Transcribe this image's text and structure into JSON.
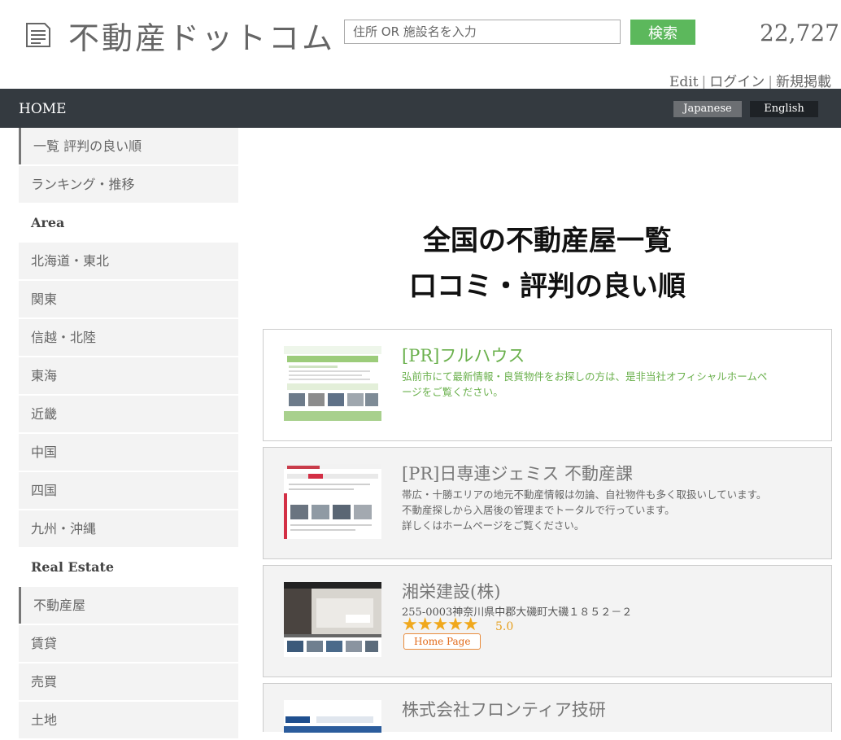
{
  "header": {
    "site_title": "不動産ドットコム",
    "search_placeholder": "住所 OR 施設名を入力",
    "search_button": "検索",
    "visitor_count": "22,727",
    "links": [
      "Edit",
      "ログイン",
      "新規掲載"
    ]
  },
  "nav": {
    "home": "HOME",
    "languages": [
      "Japanese",
      "English"
    ]
  },
  "sidebar": {
    "sort_items": [
      "一覧 評判の良い順",
      "ランキング・推移"
    ],
    "area_heading": "Area",
    "areas": [
      "北海道・東北",
      "関東",
      "信越・北陸",
      "東海",
      "近畿",
      "中国",
      "四国",
      "九州・沖縄"
    ],
    "realestate_heading": "Real Estate",
    "categories": [
      "不動産屋",
      "賃貸",
      "売買",
      "土地"
    ]
  },
  "main": {
    "title_line1": "全国の不動産屋一覧",
    "title_line2": "口コミ・評判の良い順",
    "listings": [
      {
        "name": "[PR]フルハウス",
        "desc": "弘前市にて最新情報・良質物件をお探しの方は、是非当社オフィシャルホームページをご覧ください。",
        "name_color": "#6ab04c"
      },
      {
        "name": "[PR]日専連ジェミス 不動産課",
        "desc_lines": [
          "帯広・十勝エリアの地元不動産情報は勿論、自社物件も多く取扱いしています。",
          "不動産探しから入居後の管理までトータルで行っています。",
          "詳しくはホームページをご覧ください。"
        ]
      },
      {
        "name": "湘栄建設(株)",
        "address": "255-0003神奈川県中郡大磯町大磯１８５２－２",
        "stars": "★★★★★",
        "rating": "5.0",
        "homepage": "Home Page"
      },
      {
        "name": "株式会社フロンティア技研"
      }
    ]
  },
  "colors": {
    "accent_green": "#5cb85c",
    "nav_bg": "#343a40",
    "star": "#f0a81c"
  }
}
